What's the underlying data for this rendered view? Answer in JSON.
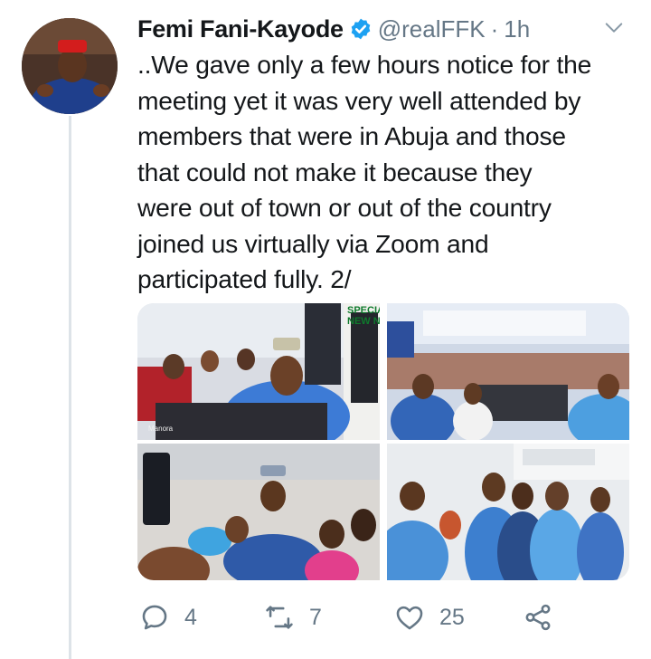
{
  "tweet": {
    "author_name": "Femi Fani-Kayode",
    "handle": "@realFFK",
    "separator": "·",
    "time": "1h",
    "text": "..We gave only a few hours notice for the\nmeeting yet it was very well attended by\nmembers that were in Abuja and those\nthat could not make it because they\nwere out of town or out of the country\njoined us virtually via Zoom and\nparticipated fully. 2/",
    "photos": [
      {
        "overlay_text": "SPECIA\nNEW N",
        "watermark": "Manora"
      },
      {},
      {},
      {}
    ]
  },
  "actions": {
    "replies": "4",
    "retweets": "7",
    "likes": "25"
  },
  "colors": {
    "muted": "#657786",
    "verified": "#1da1f2",
    "thread_line": "#dde3e8"
  },
  "icons": [
    "verified-badge-icon",
    "chevron-down-icon",
    "reply-icon",
    "retweet-icon",
    "like-icon",
    "share-icon"
  ]
}
